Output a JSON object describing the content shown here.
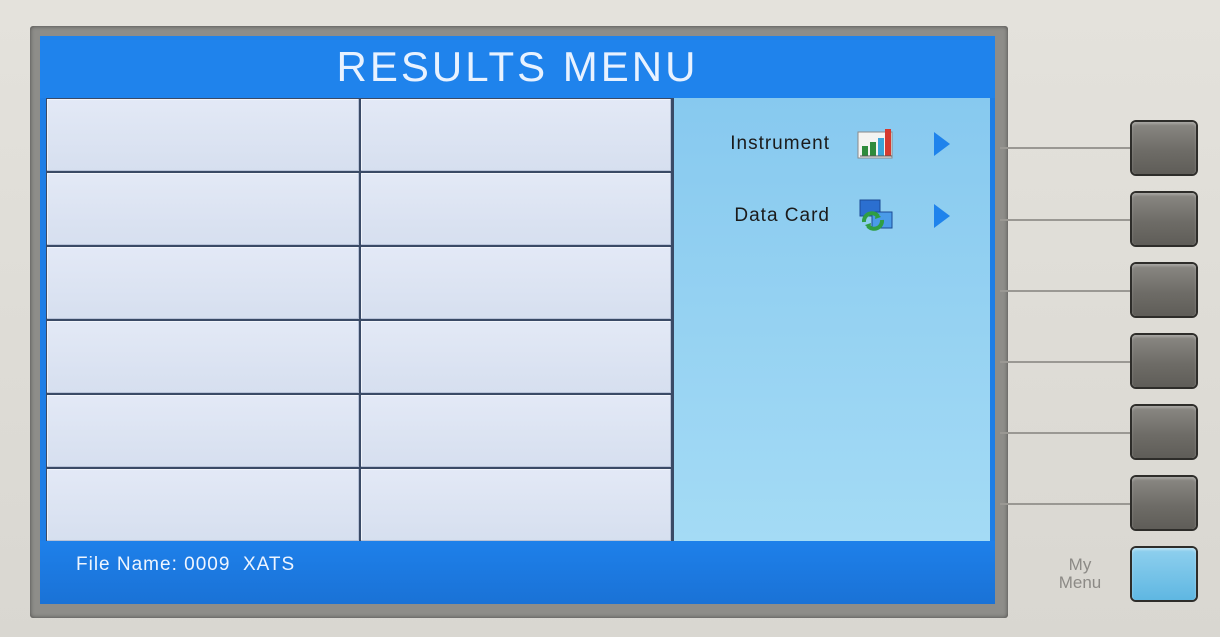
{
  "screen": {
    "title": "RESULTS MENU",
    "file_name_label": "File Name:",
    "file_name_value": "0009  XATS"
  },
  "menu": {
    "items": [
      {
        "label": "Instrument",
        "icon": "bar-chart-icon"
      },
      {
        "label": "Data Card",
        "icon": "data-sync-icon"
      }
    ]
  },
  "bezel": {
    "my_menu_line1": "My",
    "my_menu_line2": "Menu"
  },
  "colors": {
    "screen_blue": "#1f83ec",
    "panel_light_blue": "#a4dbf5",
    "cell_gray": "#dfe6f4"
  }
}
